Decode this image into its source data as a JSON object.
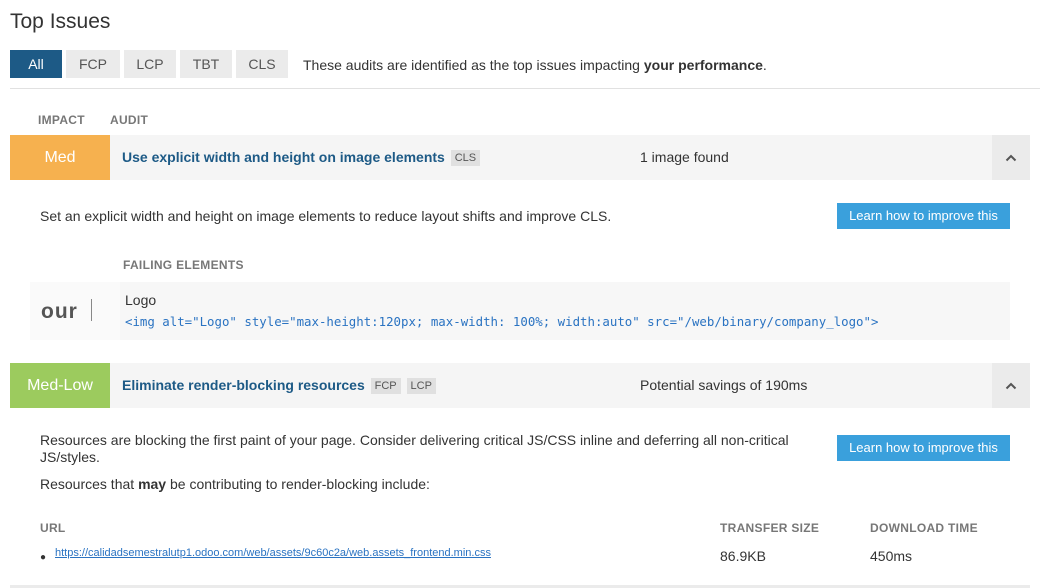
{
  "page": {
    "title": "Top Issues"
  },
  "tabs": [
    {
      "label": "All",
      "active": true
    },
    {
      "label": "FCP",
      "active": false
    },
    {
      "label": "LCP",
      "active": false
    },
    {
      "label": "TBT",
      "active": false
    },
    {
      "label": "CLS",
      "active": false
    }
  ],
  "tabs_note": {
    "prefix": "These audits are identified as the top issues impacting ",
    "bold": "your performance",
    "suffix": "."
  },
  "columns": {
    "impact": "IMPACT",
    "audit": "AUDIT"
  },
  "audits": [
    {
      "impact": "Med",
      "impact_color": "#f6b14f",
      "title": "Use explicit width and height on image elements",
      "tags": [
        "CLS"
      ],
      "summary": "1 image found",
      "description": "Set an explicit width and height on image elements to reduce layout shifts and improve CLS.",
      "button": "Learn how to improve this",
      "failing_label": "FAILING ELEMENTS",
      "failing": [
        {
          "thumb_text": "our",
          "name": "Logo",
          "code": "<img alt=\"Logo\" style=\"max-height:120px; max-width: 100%; width:auto\" src=\"/web/binary/company_logo\">"
        }
      ]
    },
    {
      "impact": "Med-Low",
      "impact_color": "#9ccb5e",
      "title": "Eliminate render-blocking resources",
      "tags": [
        "FCP",
        "LCP"
      ],
      "summary": "Potential savings of 190ms",
      "description": "Resources are blocking the first paint of your page. Consider delivering critical JS/CSS inline and deferring all non-critical JS/styles.",
      "contrib": {
        "prefix": "Resources that ",
        "bold": "may",
        "suffix": " be contributing to render-blocking include:"
      },
      "button": "Learn how to improve this",
      "resource_columns": {
        "url": "URL",
        "size": "TRANSFER SIZE",
        "time": "DOWNLOAD TIME"
      },
      "resources": [
        {
          "url": "https://calidadsemestralutp1.odoo.com/web/assets/9c60c2a/web.assets_frontend.min.css",
          "size": "86.9KB",
          "time": "450ms"
        }
      ]
    }
  ],
  "icons": {
    "collapse": "chevron-up-icon",
    "bullet": "bullet-icon"
  }
}
